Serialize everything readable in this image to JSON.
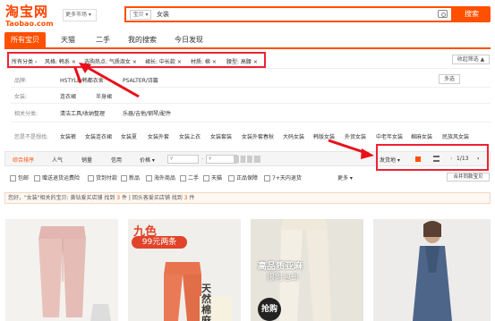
{
  "header": {
    "logo_cn": "淘宝网",
    "logo_en": "Taobao.com",
    "market_label": "更多市场 ▾",
    "search_scope": "宝贝 ▾",
    "search_query": "女装",
    "search_button": "搜索"
  },
  "tabs": [
    {
      "label": "所有宝贝"
    },
    {
      "label": "天猫"
    },
    {
      "label": "二手"
    },
    {
      "label": "我的搜索"
    },
    {
      "label": "今日发现"
    }
  ],
  "crumbs": {
    "prefix": "所有分类 ›",
    "items": [
      "风格: 韩系 ×",
      "选购热点: 气质淑女 ×",
      "裙长: 中长款 ×",
      "材质: 棉 ×",
      "腰型: 高腰 ×"
    ],
    "collapse": "收起筛选 ▲"
  },
  "filters": {
    "brand_label": "品牌:",
    "brand_values": [
      "HSTYLE/韩都衣舍",
      "PSALTER/诗篇"
    ],
    "multi": "多选",
    "women_label": "女装:",
    "women_values": [
      "连衣裙",
      "半身裙"
    ],
    "related_label": "相关分类:",
    "related_values": [
      "清洁工具/收纳整理",
      "乐器/吉他/钢琴/配件"
    ]
  },
  "recommend": {
    "label": "您是不是想找:",
    "items": [
      "女装裤",
      "女装连衣裙",
      "女装夏",
      "女装外套",
      "女装上衣",
      "女装套装",
      "女装外套春秋",
      "大码女装",
      "韩版女装",
      "外贸女装",
      "中老年女装",
      "棉麻女装",
      "民族风女装"
    ]
  },
  "sortbar": {
    "items": [
      "综合排序",
      "人气",
      "销量",
      "信用",
      "价格 ▾"
    ],
    "price_from": "¥",
    "price_to": "¥",
    "ship_from": "发货地 ▾",
    "page": "1/13"
  },
  "checks": {
    "items": [
      "包邮",
      "赠送退货运费险",
      "货到付款",
      "新品",
      "海外商品",
      "二手",
      "天猫",
      "正品保障",
      "7+天内退货"
    ],
    "more": "更多 ▾",
    "merge": "合并同款宝贝"
  },
  "notice": {
    "part1": "您好，\"女装\"相关的宝贝: 黄钻爱买店铺 找到 ",
    "count1": "3",
    "part2": " 件  |  回头客爱买店铺 找到 ",
    "count2": "3",
    "part3": " 件"
  },
  "products": [
    {
      "id": "p1"
    },
    {
      "text_top": "九色",
      "text_price": "99元两条",
      "text_side": "天然棉麻"
    },
    {
      "text_main": "高品质亚麻",
      "text_sub": "限时包邮",
      "badge": "抢购"
    },
    {
      "id": "p4"
    }
  ],
  "colors": {
    "accent": "#ff5000",
    "annotation": "#e8111a"
  }
}
